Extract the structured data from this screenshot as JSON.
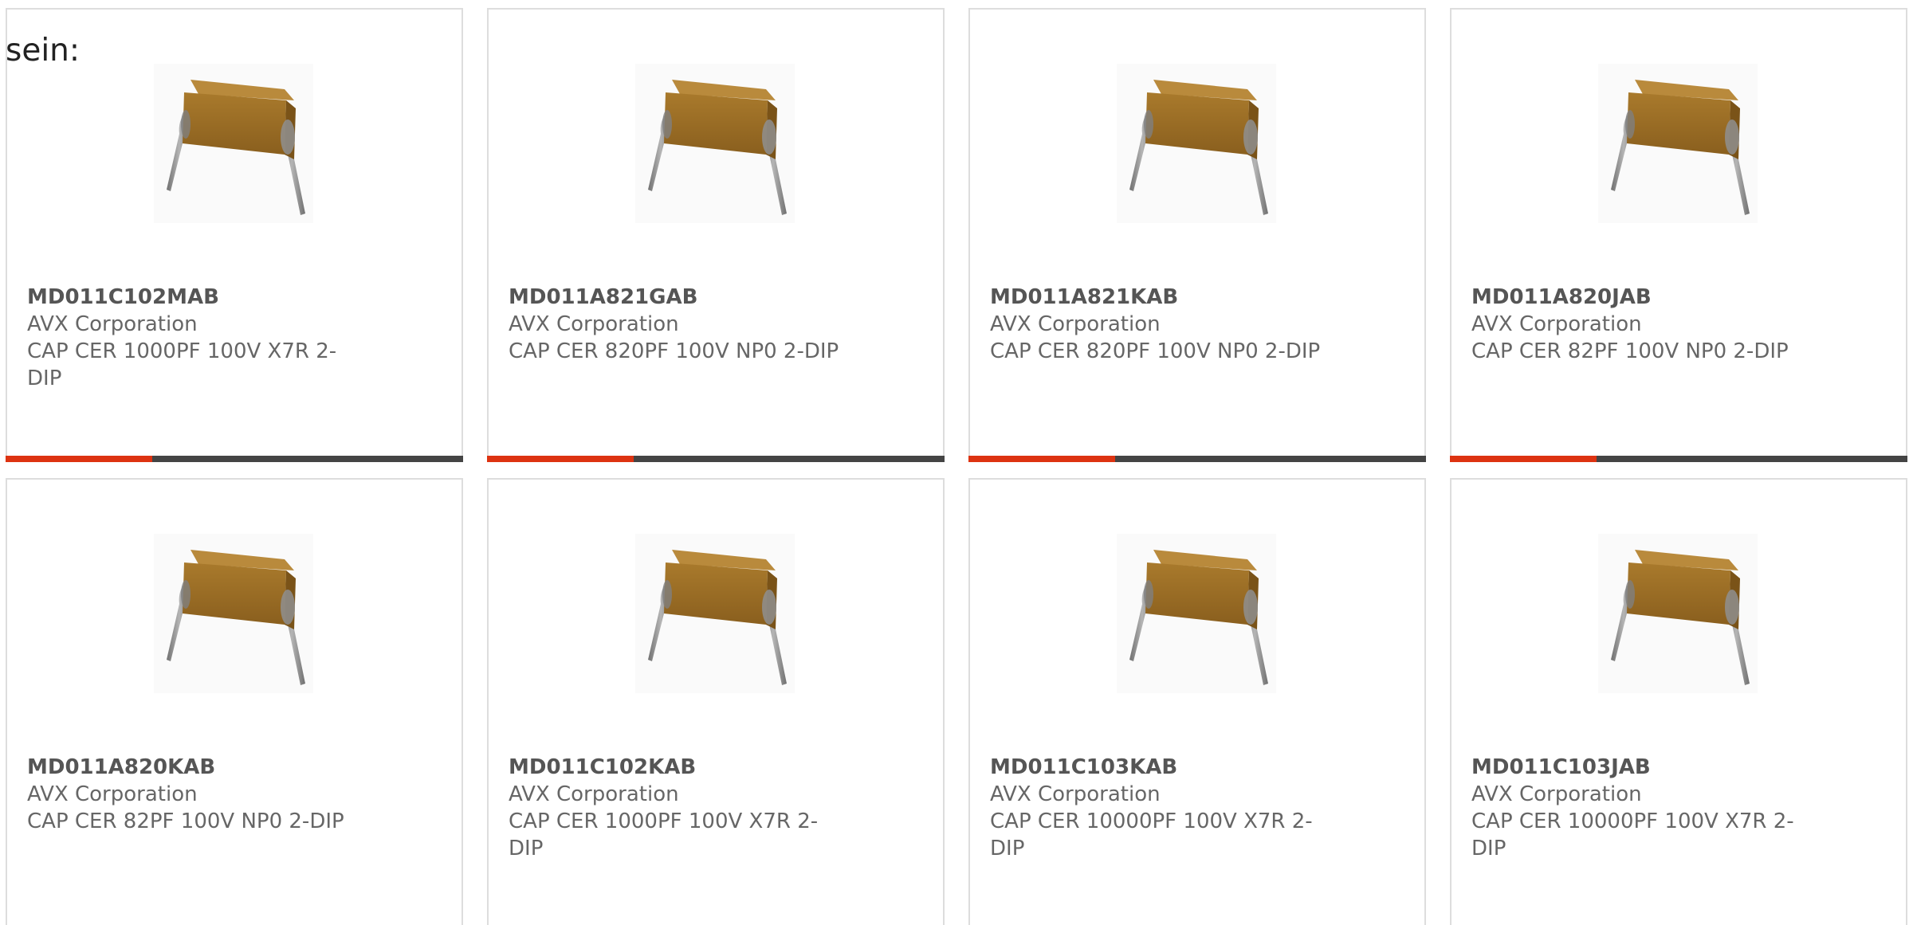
{
  "intro": {
    "text": "sein:"
  },
  "colors": {
    "accent": "#dd3311",
    "bar_track": "#444444",
    "card_border": "#dddddd",
    "text": "#666666"
  },
  "products": [
    {
      "part_number": "MD011C102MAB",
      "manufacturer": "AVX Corporation",
      "description": "CAP CER 1000PF 100V X7R 2-DIP",
      "progress": 0.32,
      "icon": "capacitor-image"
    },
    {
      "part_number": "MD011A821GAB",
      "manufacturer": "AVX Corporation",
      "description": "CAP CER 820PF 100V NP0 2-DIP",
      "progress": 0.32,
      "icon": "capacitor-image"
    },
    {
      "part_number": "MD011A821KAB",
      "manufacturer": "AVX Corporation",
      "description": "CAP CER 820PF 100V NP0 2-DIP",
      "progress": 0.32,
      "icon": "capacitor-image"
    },
    {
      "part_number": "MD011A820JAB",
      "manufacturer": "AVX Corporation",
      "description": "CAP CER 82PF 100V NP0 2-DIP",
      "progress": 0.32,
      "icon": "capacitor-image"
    },
    {
      "part_number": "MD011A820KAB",
      "manufacturer": "AVX Corporation",
      "description": "CAP CER 82PF 100V NP0 2-DIP",
      "icon": "capacitor-image"
    },
    {
      "part_number": "MD011C102KAB",
      "manufacturer": "AVX Corporation",
      "description": "CAP CER 1000PF 100V X7R 2-DIP",
      "icon": "capacitor-image"
    },
    {
      "part_number": "MD011C103KAB",
      "manufacturer": "AVX Corporation",
      "description": "CAP CER 10000PF 100V X7R 2-DIP",
      "icon": "capacitor-image"
    },
    {
      "part_number": "MD011C103JAB",
      "manufacturer": "AVX Corporation",
      "description": "CAP CER 10000PF 100V X7R 2-DIP",
      "icon": "capacitor-image"
    }
  ]
}
